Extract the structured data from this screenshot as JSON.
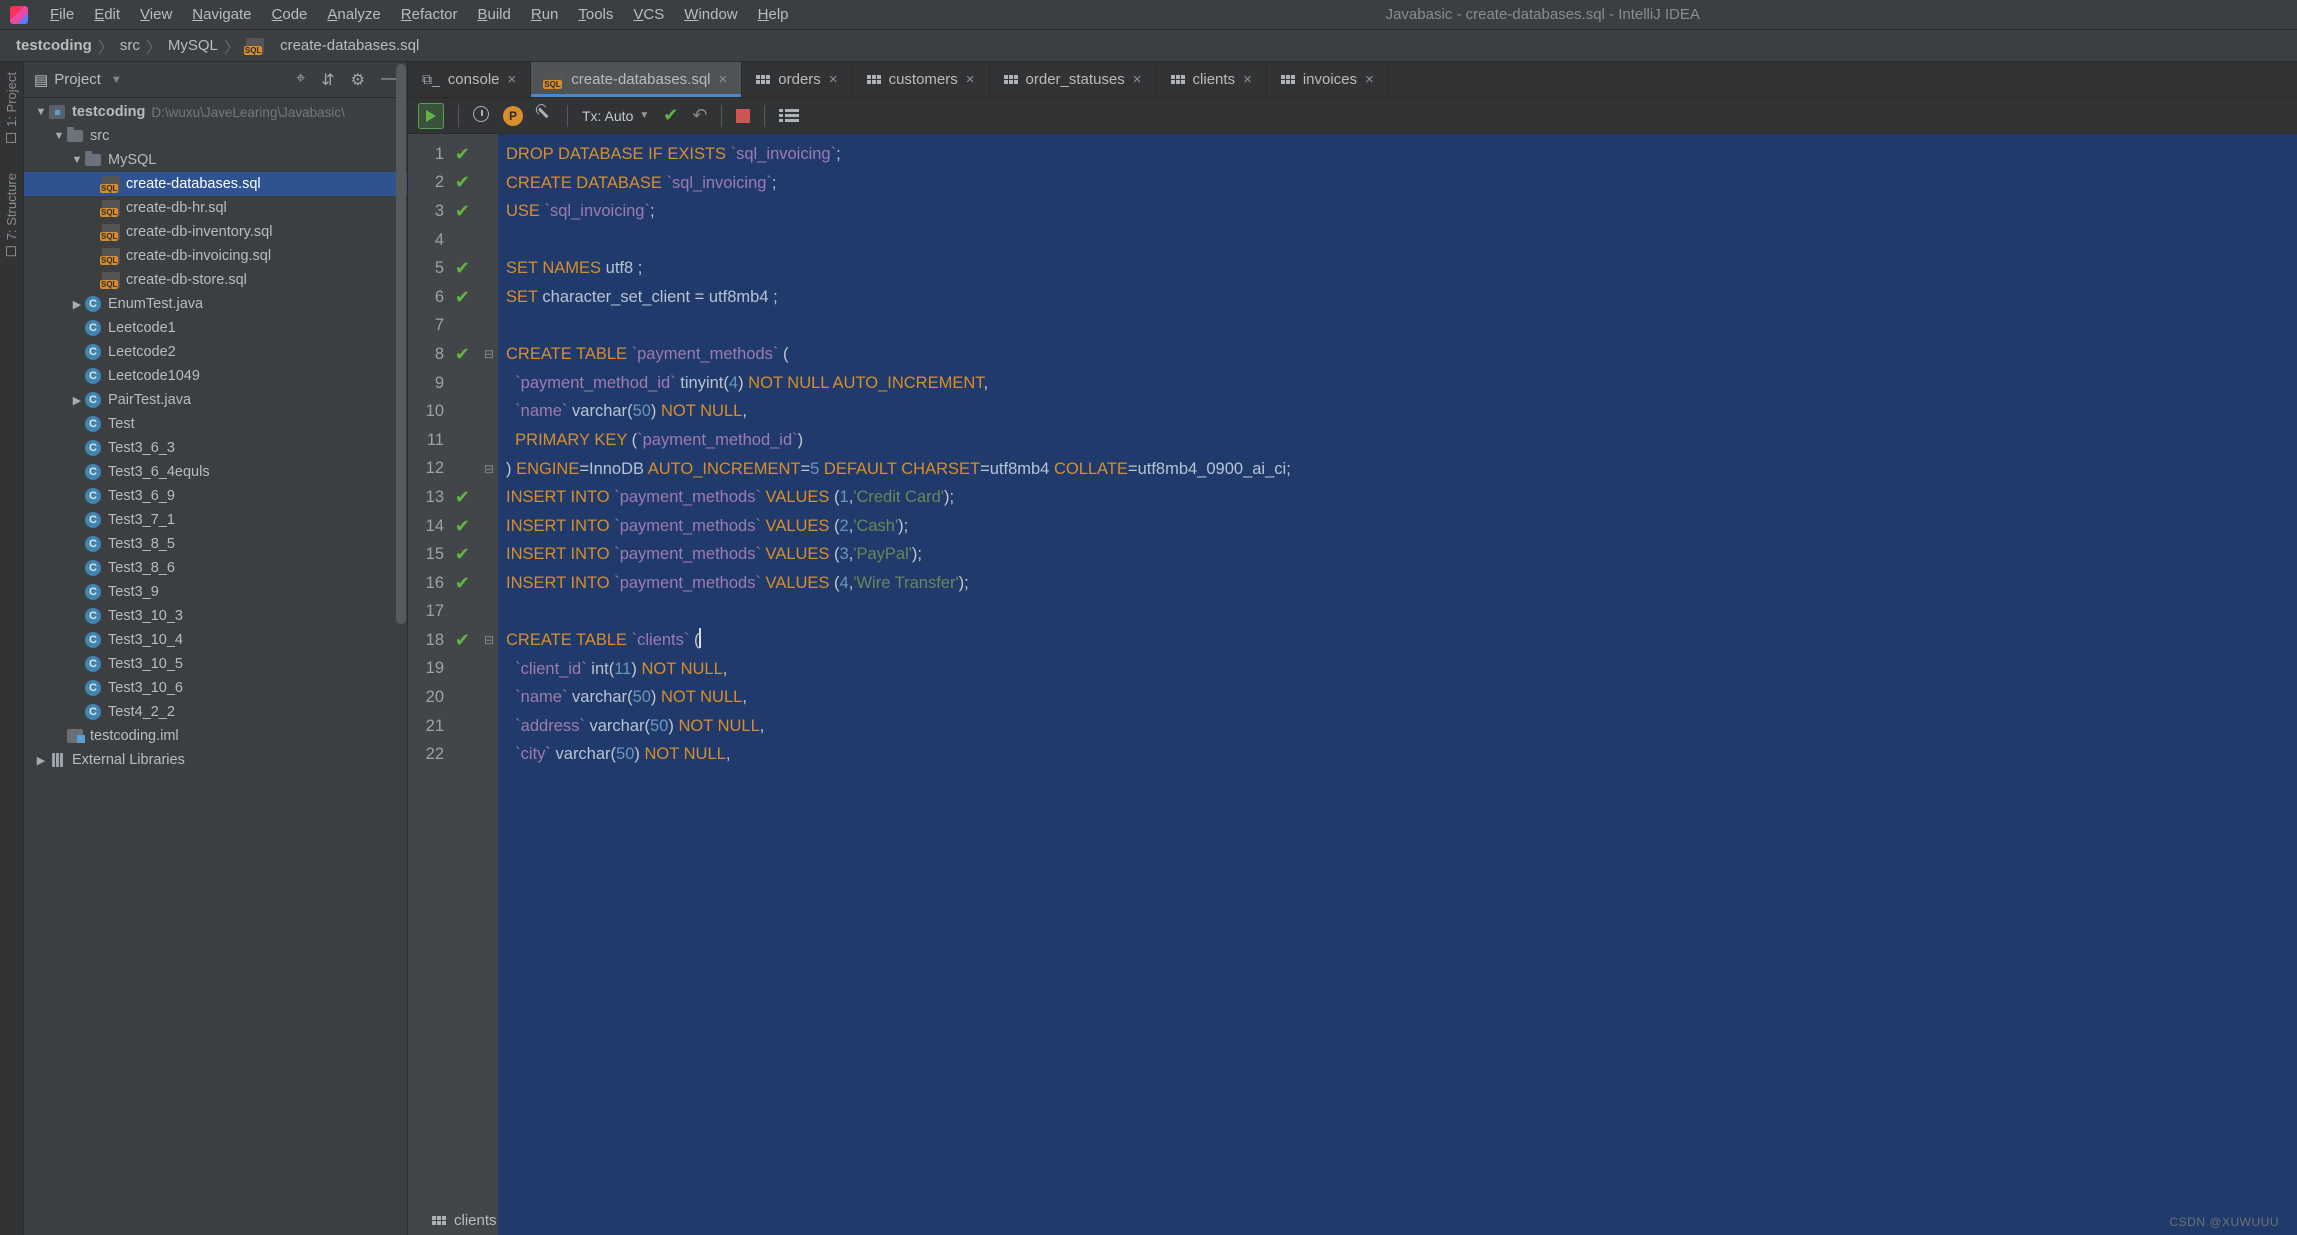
{
  "menu": {
    "items": [
      "File",
      "Edit",
      "View",
      "Navigate",
      "Code",
      "Analyze",
      "Refactor",
      "Build",
      "Run",
      "Tools",
      "VCS",
      "Window",
      "Help"
    ]
  },
  "title": "Javabasic - create-databases.sql - IntelliJ IDEA",
  "breadcrumb": {
    "root": "testcoding",
    "items": [
      "src",
      "MySQL",
      "create-databases.sql"
    ]
  },
  "side_tabs": {
    "project": "1: Project",
    "structure": "7: Structure"
  },
  "project_panel": {
    "title": "Project",
    "tools": {
      "target": "⌖",
      "collapse": "⇵",
      "gear": "⚙",
      "hide": "—"
    },
    "tree": {
      "root": {
        "name": "testcoding",
        "path": "D:\\wuxu\\JaveLearing\\Javabasic\\"
      },
      "src": "src",
      "mysql": "MySQL",
      "mysql_files": [
        "create-databases.sql",
        "create-db-hr.sql",
        "create-db-inventory.sql",
        "create-db-invoicing.sql",
        "create-db-store.sql"
      ],
      "classes": [
        "EnumTest.java",
        "Leetcode1",
        "Leetcode2",
        "Leetcode1049",
        "PairTest.java",
        "Test",
        "Test3_6_3",
        "Test3_6_4equls",
        "Test3_6_9",
        "Test3_7_1",
        "Test3_8_5",
        "Test3_8_6",
        "Test3_9",
        "Test3_10_3",
        "Test3_10_4",
        "Test3_10_5",
        "Test3_10_6",
        "Test4_2_2"
      ],
      "iml": "testcoding.iml",
      "external": "External Libraries"
    }
  },
  "tabs": [
    {
      "label": "console",
      "kind": "console"
    },
    {
      "label": "create-databases.sql",
      "kind": "sql",
      "active": true
    },
    {
      "label": "orders",
      "kind": "table"
    },
    {
      "label": "customers",
      "kind": "table"
    },
    {
      "label": "order_statuses",
      "kind": "table"
    },
    {
      "label": "clients",
      "kind": "table"
    },
    {
      "label": "invoices",
      "kind": "table"
    }
  ],
  "toolbar": {
    "tx": "Tx: Auto",
    "pill": "P"
  },
  "code": {
    "lines": [
      {
        "n": 1,
        "chk": true,
        "fold": "",
        "seg": [
          [
            "k",
            "DROP DATABASE IF EXISTS "
          ],
          [
            "bt",
            "`sql_invoicing`"
          ],
          [
            "pnc",
            ";"
          ]
        ]
      },
      {
        "n": 2,
        "chk": true,
        "fold": "",
        "seg": [
          [
            "k",
            "CREATE DATABASE "
          ],
          [
            "bt",
            "`sql_invoicing`"
          ],
          [
            "pnc",
            ";"
          ]
        ]
      },
      {
        "n": 3,
        "chk": true,
        "fold": "",
        "seg": [
          [
            "k",
            "USE "
          ],
          [
            "bt",
            "`sql_invoicing`"
          ],
          [
            "pnc",
            ";"
          ]
        ]
      },
      {
        "n": 4,
        "chk": false,
        "fold": "",
        "seg": []
      },
      {
        "n": 5,
        "chk": true,
        "fold": "",
        "seg": [
          [
            "k",
            "SET NAMES "
          ],
          [
            "fn",
            "utf8 "
          ],
          [
            "pnc",
            ";"
          ]
        ]
      },
      {
        "n": 6,
        "chk": true,
        "fold": "",
        "seg": [
          [
            "k",
            "SET "
          ],
          [
            "fn",
            "character_set_client "
          ],
          [
            "pnc",
            "= "
          ],
          [
            "fn",
            "utf8mb4 "
          ],
          [
            "pnc",
            ";"
          ]
        ]
      },
      {
        "n": 7,
        "chk": false,
        "fold": "",
        "seg": []
      },
      {
        "n": 8,
        "chk": true,
        "fold": "⊟",
        "seg": [
          [
            "k",
            "CREATE TABLE "
          ],
          [
            "bt",
            "`payment_methods`"
          ],
          [
            "pnc",
            " ("
          ]
        ]
      },
      {
        "n": 9,
        "chk": false,
        "fold": "",
        "seg": [
          [
            "pnc",
            "  "
          ],
          [
            "bt",
            "`payment_method_id`"
          ],
          [
            "pnc",
            " "
          ],
          [
            "fn",
            "tinyint"
          ],
          [
            "pnc",
            "("
          ],
          [
            "n",
            "4"
          ],
          [
            "pnc",
            ") "
          ],
          [
            "k",
            "NOT NULL AUTO_INCREMENT"
          ],
          [
            "pnc",
            ","
          ]
        ]
      },
      {
        "n": 10,
        "chk": false,
        "fold": "",
        "seg": [
          [
            "pnc",
            "  "
          ],
          [
            "bt",
            "`name`"
          ],
          [
            "pnc",
            " "
          ],
          [
            "fn",
            "varchar"
          ],
          [
            "pnc",
            "("
          ],
          [
            "n",
            "50"
          ],
          [
            "pnc",
            ") "
          ],
          [
            "k",
            "NOT NULL"
          ],
          [
            "pnc",
            ","
          ]
        ]
      },
      {
        "n": 11,
        "chk": false,
        "fold": "",
        "seg": [
          [
            "pnc",
            "  "
          ],
          [
            "k",
            "PRIMARY KEY "
          ],
          [
            "pnc",
            "("
          ],
          [
            "bt",
            "`payment_method_id`"
          ],
          [
            "pnc",
            ")"
          ]
        ]
      },
      {
        "n": 12,
        "chk": false,
        "fold": "⊟",
        "seg": [
          [
            "pnc",
            ") "
          ],
          [
            "k",
            "ENGINE"
          ],
          [
            "pnc",
            "="
          ],
          [
            "fn",
            "InnoDB "
          ],
          [
            "k",
            "AUTO_INCREMENT"
          ],
          [
            "pnc",
            "="
          ],
          [
            "n",
            "5 "
          ],
          [
            "k",
            "DEFAULT CHARSET"
          ],
          [
            "pnc",
            "="
          ],
          [
            "fn",
            "utf8mb4 "
          ],
          [
            "k",
            "COLLATE"
          ],
          [
            "pnc",
            "="
          ],
          [
            "fn",
            "utf8mb4_0900_ai_ci"
          ],
          [
            "pnc",
            ";"
          ]
        ]
      },
      {
        "n": 13,
        "chk": true,
        "fold": "",
        "seg": [
          [
            "k",
            "INSERT INTO "
          ],
          [
            "bt",
            "`payment_methods`"
          ],
          [
            "pnc",
            " "
          ],
          [
            "k",
            "VALUES "
          ],
          [
            "pnc",
            "("
          ],
          [
            "n",
            "1"
          ],
          [
            "pnc",
            ","
          ],
          [
            "s",
            "'Credit Card'"
          ],
          [
            "pnc",
            ");"
          ]
        ]
      },
      {
        "n": 14,
        "chk": true,
        "fold": "",
        "seg": [
          [
            "k",
            "INSERT INTO "
          ],
          [
            "bt",
            "`payment_methods`"
          ],
          [
            "pnc",
            " "
          ],
          [
            "k",
            "VALUES "
          ],
          [
            "pnc",
            "("
          ],
          [
            "n",
            "2"
          ],
          [
            "pnc",
            ","
          ],
          [
            "s",
            "'Cash'"
          ],
          [
            "pnc",
            ");"
          ]
        ]
      },
      {
        "n": 15,
        "chk": true,
        "fold": "",
        "seg": [
          [
            "k",
            "INSERT INTO "
          ],
          [
            "bt",
            "`payment_methods`"
          ],
          [
            "pnc",
            " "
          ],
          [
            "k",
            "VALUES "
          ],
          [
            "pnc",
            "("
          ],
          [
            "n",
            "3"
          ],
          [
            "pnc",
            ","
          ],
          [
            "s",
            "'PayPal'"
          ],
          [
            "pnc",
            ");"
          ]
        ]
      },
      {
        "n": 16,
        "chk": true,
        "fold": "",
        "seg": [
          [
            "k",
            "INSERT INTO "
          ],
          [
            "bt",
            "`payment_methods`"
          ],
          [
            "pnc",
            " "
          ],
          [
            "k",
            "VALUES "
          ],
          [
            "pnc",
            "("
          ],
          [
            "n",
            "4"
          ],
          [
            "pnc",
            ","
          ],
          [
            "s",
            "'Wire Transfer'"
          ],
          [
            "pnc",
            ");"
          ]
        ]
      },
      {
        "n": 17,
        "chk": false,
        "fold": "",
        "seg": []
      },
      {
        "n": 18,
        "chk": true,
        "fold": "⊟",
        "caret": true,
        "seg": [
          [
            "k",
            "CREATE TABLE "
          ],
          [
            "bt",
            "`clients`"
          ],
          [
            "pnc",
            " ("
          ]
        ]
      },
      {
        "n": 19,
        "chk": false,
        "fold": "",
        "seg": [
          [
            "pnc",
            "  "
          ],
          [
            "bt",
            "`client_id`"
          ],
          [
            "pnc",
            " "
          ],
          [
            "fn",
            "int"
          ],
          [
            "pnc",
            "("
          ],
          [
            "n",
            "11"
          ],
          [
            "pnc",
            ") "
          ],
          [
            "k",
            "NOT NULL"
          ],
          [
            "pnc",
            ","
          ]
        ]
      },
      {
        "n": 20,
        "chk": false,
        "fold": "",
        "seg": [
          [
            "pnc",
            "  "
          ],
          [
            "bt",
            "`name`"
          ],
          [
            "pnc",
            " "
          ],
          [
            "fn",
            "varchar"
          ],
          [
            "pnc",
            "("
          ],
          [
            "n",
            "50"
          ],
          [
            "pnc",
            ") "
          ],
          [
            "k",
            "NOT NULL"
          ],
          [
            "pnc",
            ","
          ]
        ]
      },
      {
        "n": 21,
        "chk": false,
        "fold": "",
        "seg": [
          [
            "pnc",
            "  "
          ],
          [
            "bt",
            "`address`"
          ],
          [
            "pnc",
            " "
          ],
          [
            "fn",
            "varchar"
          ],
          [
            "pnc",
            "("
          ],
          [
            "n",
            "50"
          ],
          [
            "pnc",
            ") "
          ],
          [
            "k",
            "NOT NULL"
          ],
          [
            "pnc",
            ","
          ]
        ]
      },
      {
        "n": 22,
        "chk": false,
        "fold": "",
        "seg": [
          [
            "pnc",
            "  "
          ],
          [
            "bt",
            "`city`"
          ],
          [
            "pnc",
            " "
          ],
          [
            "fn",
            "varchar"
          ],
          [
            "pnc",
            "("
          ],
          [
            "n",
            "50"
          ],
          [
            "pnc",
            ") "
          ],
          [
            "k",
            "NOT NULL"
          ],
          [
            "pnc",
            ","
          ]
        ]
      }
    ]
  },
  "status": {
    "context": "clients"
  },
  "watermark": "CSDN @XUWUUU"
}
